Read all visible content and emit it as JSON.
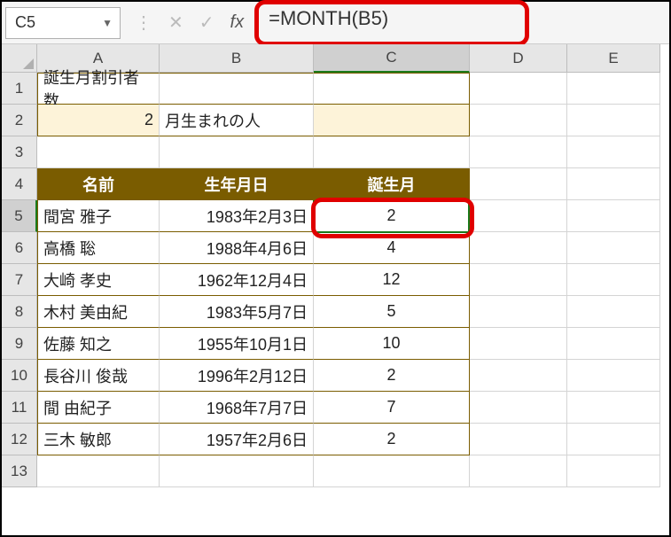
{
  "namebox": "C5",
  "formula": "=MONTH(B5)",
  "cols": [
    "A",
    "B",
    "C",
    "D",
    "E"
  ],
  "rows": [
    "1",
    "2",
    "3",
    "4",
    "5",
    "6",
    "7",
    "8",
    "9",
    "10",
    "11",
    "12",
    "13"
  ],
  "r1": {
    "a": "誕生月割引者数"
  },
  "r2": {
    "a": "2",
    "b": "月生まれの人"
  },
  "r4": {
    "a": "名前",
    "b": "生年月日",
    "c": "誕生月"
  },
  "data": [
    {
      "name": "間宮 雅子",
      "date": "1983年2月3日",
      "month": "2"
    },
    {
      "name": "高橋 聡",
      "date": "1988年4月6日",
      "month": "4"
    },
    {
      "name": "大崎 孝史",
      "date": "1962年12月4日",
      "month": "12"
    },
    {
      "name": "木村 美由紀",
      "date": "1983年5月7日",
      "month": "5"
    },
    {
      "name": "佐藤 知之",
      "date": "1955年10月1日",
      "month": "10"
    },
    {
      "name": "長谷川 俊哉",
      "date": "1996年2月12日",
      "month": "2"
    },
    {
      "name": "間 由紀子",
      "date": "1968年7月7日",
      "month": "7"
    },
    {
      "name": "三木 敏郎",
      "date": "1957年2月6日",
      "month": "2"
    }
  ]
}
